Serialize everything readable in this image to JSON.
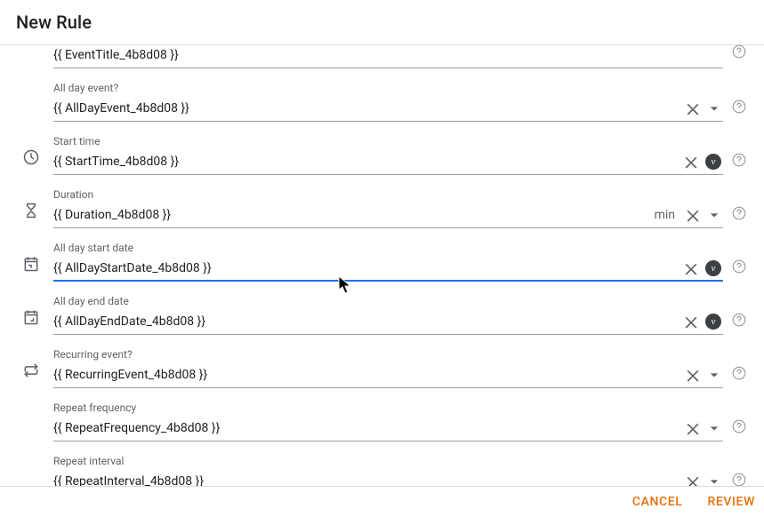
{
  "header": {
    "title": "New Rule"
  },
  "fields": {
    "eventTitle": {
      "value": "{{ EventTitle_4b8d08 }}"
    },
    "allDayEvent": {
      "label": "All day event?",
      "value": "{{ AllDayEvent_4b8d08 }}"
    },
    "startTime": {
      "label": "Start time",
      "value": "{{ StartTime_4b8d08 }}",
      "chip": "v"
    },
    "duration": {
      "label": "Duration",
      "value": "{{ Duration_4b8d08 }}",
      "suffix": "min"
    },
    "allDayStartDate": {
      "label": "All day start date",
      "value": "{{ AllDayStartDate_4b8d08 }}",
      "chip": "v"
    },
    "allDayEndDate": {
      "label": "All day end date",
      "value": "{{ AllDayEndDate_4b8d08 }}",
      "chip": "v"
    },
    "recurringEvent": {
      "label": "Recurring event?",
      "value": "{{ RecurringEvent_4b8d08 }}"
    },
    "repeatFrequency": {
      "label": "Repeat frequency",
      "value": "{{ RepeatFrequency_4b8d08 }}"
    },
    "repeatInterval": {
      "label": "Repeat interval",
      "value": "{{ RepeatInterval_4b8d08 }}"
    }
  },
  "footer": {
    "cancel": "CANCEL",
    "review": "REVIEW"
  }
}
